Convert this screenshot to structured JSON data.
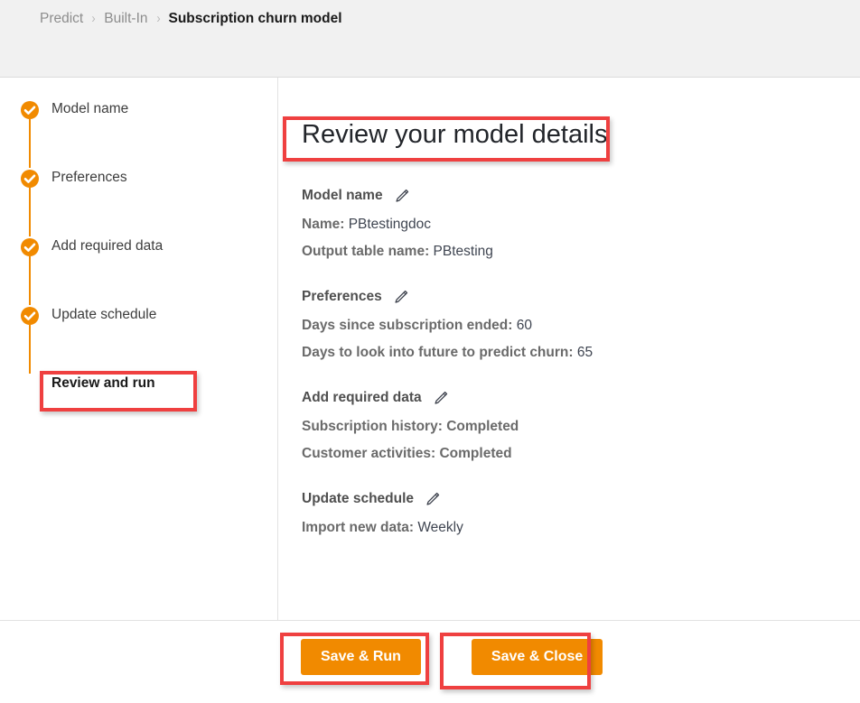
{
  "breadcrumb": {
    "items": [
      {
        "label": "Predict",
        "current": false
      },
      {
        "label": "Built-In",
        "current": false
      },
      {
        "label": "Subscription churn model",
        "current": true
      }
    ],
    "separator": "›"
  },
  "sidebar": {
    "steps": [
      {
        "label": "Model name",
        "state": "completed",
        "icon": "check-circle-icon"
      },
      {
        "label": "Preferences",
        "state": "completed",
        "icon": "check-circle-icon"
      },
      {
        "label": "Add required data",
        "state": "completed",
        "icon": "check-circle-icon"
      },
      {
        "label": "Update schedule",
        "state": "completed",
        "icon": "check-circle-icon"
      },
      {
        "label": "Review and run",
        "state": "current",
        "icon": "dot-icon"
      }
    ]
  },
  "main": {
    "title": "Review your model details",
    "sections": [
      {
        "heading": "Model name",
        "edit_icon": "pencil-icon",
        "fields": [
          {
            "label": "Name:",
            "value": "PBtestingdoc",
            "bold_value": false
          },
          {
            "label": "Output table name:",
            "value": "PBtesting",
            "bold_value": false
          }
        ]
      },
      {
        "heading": "Preferences",
        "edit_icon": "pencil-icon",
        "fields": [
          {
            "label": "Days since subscription ended:",
            "value": "60",
            "bold_value": false
          },
          {
            "label": "Days to look into future to predict churn:",
            "value": "65",
            "bold_value": false
          }
        ]
      },
      {
        "heading": "Add required data",
        "edit_icon": "pencil-icon",
        "fields": [
          {
            "label": "Subscription history:",
            "value": "Completed",
            "bold_value": true
          },
          {
            "label": "Customer activities:",
            "value": "Completed",
            "bold_value": true
          }
        ]
      },
      {
        "heading": "Update schedule",
        "edit_icon": "pencil-icon",
        "fields": [
          {
            "label": "Import new data:",
            "value": "Weekly",
            "bold_value": false
          }
        ]
      }
    ]
  },
  "footer": {
    "save_run_label": "Save & Run",
    "save_close_label": "Save & Close"
  },
  "colors": {
    "accent_orange": "#f18a00",
    "annotation_red": "#ef4040",
    "header_background": "#f1f1f1",
    "label_gray": "#6a6a6a",
    "value_gray": "#3f4551"
  }
}
